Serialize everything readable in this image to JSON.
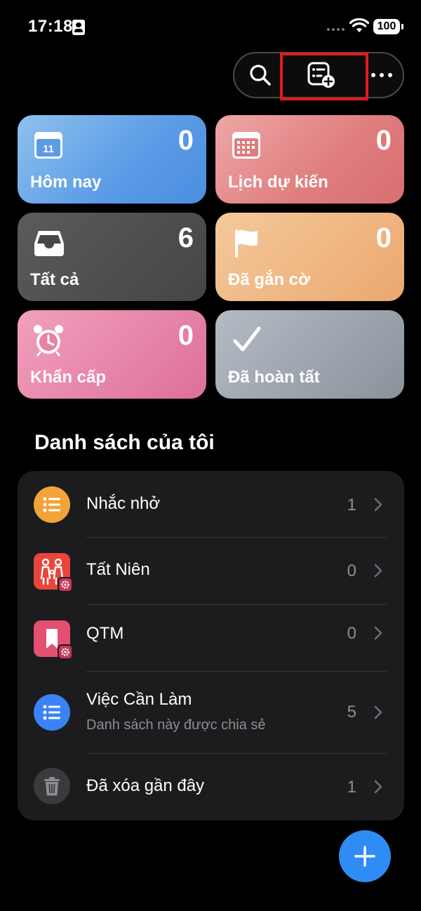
{
  "status_bar": {
    "time": "17:18",
    "battery": "100"
  },
  "toolbar": {
    "search_icon": "search-icon",
    "add_list_icon": "add-list-icon",
    "more_icon": "more-icon"
  },
  "smart_lists": {
    "today": {
      "label": "Hôm nay",
      "count": "0",
      "icon_text": "11",
      "color": "#5a9be6"
    },
    "scheduled": {
      "label": "Lịch dự kiến",
      "count": "0",
      "color": "#df7d7e"
    },
    "all": {
      "label": "Tất cả",
      "count": "6",
      "color": "#4a4a4c"
    },
    "flagged": {
      "label": "Đã gắn cờ",
      "count": "0",
      "color": "#eba86f"
    },
    "urgent": {
      "label": "Khẩn cấp",
      "count": "0",
      "color": "#dd6f99"
    },
    "completed": {
      "label": "Đã hoàn tất",
      "color": "#9aa1aa"
    }
  },
  "my_lists": {
    "title": "Danh sách của tôi",
    "items": [
      {
        "name": "Nhắc nhở",
        "count": "1",
        "icon": "list-bullet-icon",
        "color": "#f2a33a"
      },
      {
        "name": "Tất Niên",
        "count": "0",
        "icon": "family-icon",
        "color": "#e8453c"
      },
      {
        "name": "QTM",
        "count": "0",
        "icon": "bookmark-icon",
        "color": "#e4506f"
      },
      {
        "name": "Việc Cần Làm",
        "subtitle": "Danh sách này được chia sẻ",
        "count": "5",
        "icon": "list-bullet-icon",
        "color": "#3a82f6"
      },
      {
        "name": "Đã xóa gần đây",
        "count": "1",
        "icon": "trash-icon",
        "color": "#3a3a3c"
      }
    ]
  },
  "fab": {
    "icon": "plus-icon",
    "color": "#2f8cf5"
  }
}
